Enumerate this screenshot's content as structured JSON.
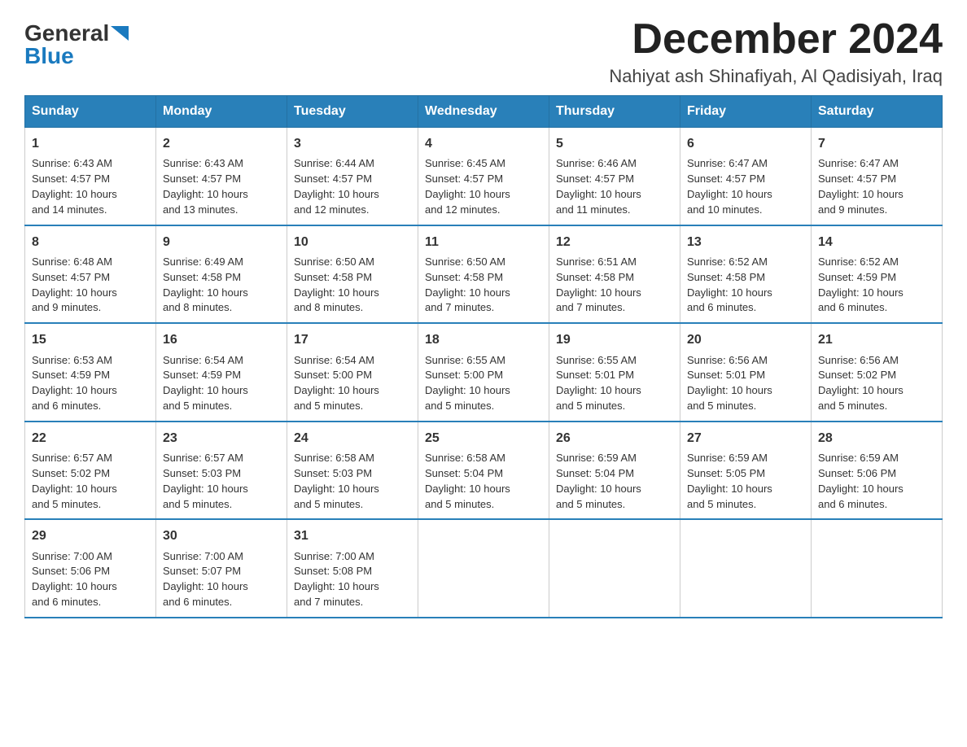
{
  "header": {
    "logo_general": "General",
    "logo_blue": "Blue",
    "month": "December 2024",
    "location": "Nahiyat ash Shinafiyah, Al Qadisiyah, Iraq"
  },
  "days_of_week": [
    "Sunday",
    "Monday",
    "Tuesday",
    "Wednesday",
    "Thursday",
    "Friday",
    "Saturday"
  ],
  "weeks": [
    [
      {
        "day": "1",
        "sunrise": "6:43 AM",
        "sunset": "4:57 PM",
        "daylight": "10 hours and 14 minutes."
      },
      {
        "day": "2",
        "sunrise": "6:43 AM",
        "sunset": "4:57 PM",
        "daylight": "10 hours and 13 minutes."
      },
      {
        "day": "3",
        "sunrise": "6:44 AM",
        "sunset": "4:57 PM",
        "daylight": "10 hours and 12 minutes."
      },
      {
        "day": "4",
        "sunrise": "6:45 AM",
        "sunset": "4:57 PM",
        "daylight": "10 hours and 12 minutes."
      },
      {
        "day": "5",
        "sunrise": "6:46 AM",
        "sunset": "4:57 PM",
        "daylight": "10 hours and 11 minutes."
      },
      {
        "day": "6",
        "sunrise": "6:47 AM",
        "sunset": "4:57 PM",
        "daylight": "10 hours and 10 minutes."
      },
      {
        "day": "7",
        "sunrise": "6:47 AM",
        "sunset": "4:57 PM",
        "daylight": "10 hours and 9 minutes."
      }
    ],
    [
      {
        "day": "8",
        "sunrise": "6:48 AM",
        "sunset": "4:57 PM",
        "daylight": "10 hours and 9 minutes."
      },
      {
        "day": "9",
        "sunrise": "6:49 AM",
        "sunset": "4:58 PM",
        "daylight": "10 hours and 8 minutes."
      },
      {
        "day": "10",
        "sunrise": "6:50 AM",
        "sunset": "4:58 PM",
        "daylight": "10 hours and 8 minutes."
      },
      {
        "day": "11",
        "sunrise": "6:50 AM",
        "sunset": "4:58 PM",
        "daylight": "10 hours and 7 minutes."
      },
      {
        "day": "12",
        "sunrise": "6:51 AM",
        "sunset": "4:58 PM",
        "daylight": "10 hours and 7 minutes."
      },
      {
        "day": "13",
        "sunrise": "6:52 AM",
        "sunset": "4:58 PM",
        "daylight": "10 hours and 6 minutes."
      },
      {
        "day": "14",
        "sunrise": "6:52 AM",
        "sunset": "4:59 PM",
        "daylight": "10 hours and 6 minutes."
      }
    ],
    [
      {
        "day": "15",
        "sunrise": "6:53 AM",
        "sunset": "4:59 PM",
        "daylight": "10 hours and 6 minutes."
      },
      {
        "day": "16",
        "sunrise": "6:54 AM",
        "sunset": "4:59 PM",
        "daylight": "10 hours and 5 minutes."
      },
      {
        "day": "17",
        "sunrise": "6:54 AM",
        "sunset": "5:00 PM",
        "daylight": "10 hours and 5 minutes."
      },
      {
        "day": "18",
        "sunrise": "6:55 AM",
        "sunset": "5:00 PM",
        "daylight": "10 hours and 5 minutes."
      },
      {
        "day": "19",
        "sunrise": "6:55 AM",
        "sunset": "5:01 PM",
        "daylight": "10 hours and 5 minutes."
      },
      {
        "day": "20",
        "sunrise": "6:56 AM",
        "sunset": "5:01 PM",
        "daylight": "10 hours and 5 minutes."
      },
      {
        "day": "21",
        "sunrise": "6:56 AM",
        "sunset": "5:02 PM",
        "daylight": "10 hours and 5 minutes."
      }
    ],
    [
      {
        "day": "22",
        "sunrise": "6:57 AM",
        "sunset": "5:02 PM",
        "daylight": "10 hours and 5 minutes."
      },
      {
        "day": "23",
        "sunrise": "6:57 AM",
        "sunset": "5:03 PM",
        "daylight": "10 hours and 5 minutes."
      },
      {
        "day": "24",
        "sunrise": "6:58 AM",
        "sunset": "5:03 PM",
        "daylight": "10 hours and 5 minutes."
      },
      {
        "day": "25",
        "sunrise": "6:58 AM",
        "sunset": "5:04 PM",
        "daylight": "10 hours and 5 minutes."
      },
      {
        "day": "26",
        "sunrise": "6:59 AM",
        "sunset": "5:04 PM",
        "daylight": "10 hours and 5 minutes."
      },
      {
        "day": "27",
        "sunrise": "6:59 AM",
        "sunset": "5:05 PM",
        "daylight": "10 hours and 5 minutes."
      },
      {
        "day": "28",
        "sunrise": "6:59 AM",
        "sunset": "5:06 PM",
        "daylight": "10 hours and 6 minutes."
      }
    ],
    [
      {
        "day": "29",
        "sunrise": "7:00 AM",
        "sunset": "5:06 PM",
        "daylight": "10 hours and 6 minutes."
      },
      {
        "day": "30",
        "sunrise": "7:00 AM",
        "sunset": "5:07 PM",
        "daylight": "10 hours and 6 minutes."
      },
      {
        "day": "31",
        "sunrise": "7:00 AM",
        "sunset": "5:08 PM",
        "daylight": "10 hours and 7 minutes."
      },
      null,
      null,
      null,
      null
    ]
  ],
  "labels": {
    "sunrise": "Sunrise:",
    "sunset": "Sunset:",
    "daylight": "Daylight:"
  }
}
